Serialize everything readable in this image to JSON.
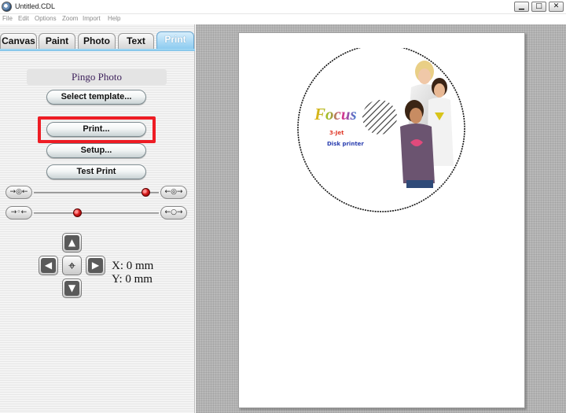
{
  "window": {
    "title": "Untitled.CDL",
    "controls": {
      "minimize": "▁",
      "maximize": "□",
      "close": "✕"
    }
  },
  "menu": [
    "File",
    "Edit",
    "Options",
    "Zoom",
    "Import",
    "Help"
  ],
  "tabs": [
    {
      "label": "Canvas",
      "active": false
    },
    {
      "label": "Paint",
      "active": false
    },
    {
      "label": "Photo",
      "active": false
    },
    {
      "label": "Text",
      "active": false
    },
    {
      "label": "Print",
      "active": true
    }
  ],
  "panel": {
    "template_name": "Pingo Photo",
    "buttons": {
      "select_template": "Select template...",
      "print": "Print...",
      "setup": "Setup...",
      "test_print": "Test Print"
    },
    "slider1": {
      "value": 0.9,
      "left_icon": "→◎←",
      "right_icon": "←◎→"
    },
    "slider2": {
      "value": 0.35,
      "left_icon": "→◦←",
      "right_icon": "←○→"
    },
    "nudge": {
      "up_icon": "arrow-up-icon",
      "down_icon": "arrow-down-icon",
      "left_icon": "arrow-left-icon",
      "right_icon": "arrow-right-icon",
      "center_icon": "crosshair-icon"
    },
    "coords": {
      "x": "X: 0 mm",
      "y": "Y: 0 mm"
    }
  },
  "disc": {
    "brand": "Focus",
    "line1": "3-Jet",
    "line2": "Disk printer"
  },
  "colors": {
    "tab_active": "#8ccbf0",
    "highlight": "#ee1c24",
    "knob": "#d81c1c"
  }
}
